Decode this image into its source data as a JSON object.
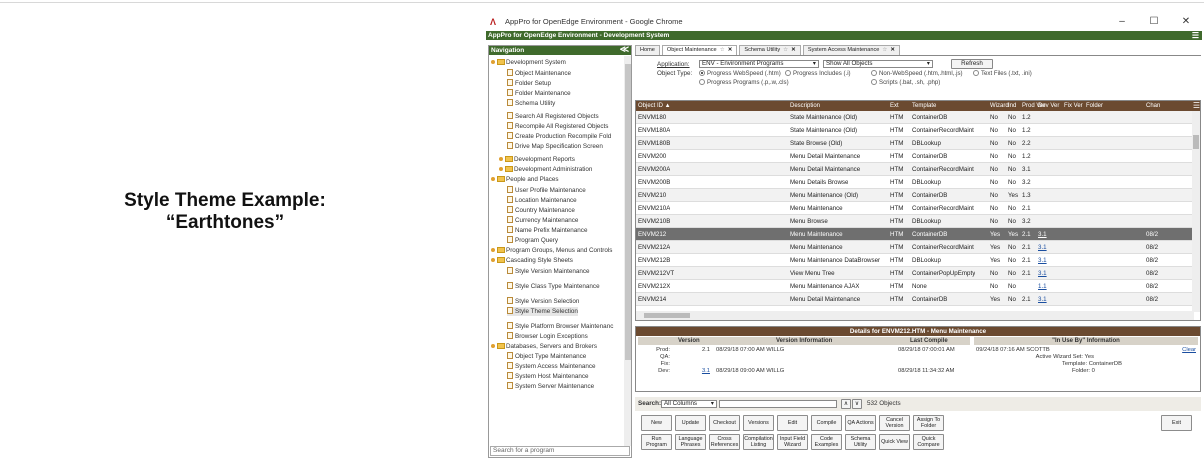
{
  "caption": {
    "line1": "Style Theme Example:",
    "line2": "“Earthtones”"
  },
  "window": {
    "title": "AppPro for OpenEdge Environment - Google Chrome",
    "app_bar": "AppPro for OpenEdge Environment - Development System",
    "minimize": "–",
    "restore": "☐",
    "close": "✕",
    "menu": "☰"
  },
  "nav": {
    "title": "Navigation",
    "collapse": "≪",
    "items": [
      {
        "label": "Development System",
        "type": "folder"
      },
      {
        "label": "Object Maintenance",
        "type": "doc"
      },
      {
        "label": "Folder Setup",
        "type": "doc"
      },
      {
        "label": "Folder Maintenance",
        "type": "doc"
      },
      {
        "label": "Schema Utility",
        "type": "doc"
      },
      {
        "label": "Search All Registered Objects",
        "type": "doc"
      },
      {
        "label": "Recompile All Registered Objects",
        "type": "doc"
      },
      {
        "label": "Create Production Recompile Fold",
        "type": "doc"
      },
      {
        "label": "Drive Map Specification Screen",
        "type": "doc"
      },
      {
        "label": "Development Reports",
        "type": "folder2"
      },
      {
        "label": "Development Administration",
        "type": "folder2"
      },
      {
        "label": "People and Places",
        "type": "folder"
      },
      {
        "label": "User Profile Maintenance",
        "type": "doc"
      },
      {
        "label": "Location Maintenance",
        "type": "doc"
      },
      {
        "label": "Country Maintenance",
        "type": "doc"
      },
      {
        "label": "Currency Maintenance",
        "type": "doc"
      },
      {
        "label": "Name Prefix Maintenance",
        "type": "doc"
      },
      {
        "label": "Program Query",
        "type": "doc"
      },
      {
        "label": "Program Groups, Menus and Controls",
        "type": "folder"
      },
      {
        "label": "Cascading Style Sheets",
        "type": "folder"
      },
      {
        "label": "Style Version Maintenance",
        "type": "doc"
      },
      {
        "label": "Style Class Type Maintenance",
        "type": "doc"
      },
      {
        "label": "Style Version Selection",
        "type": "doc"
      },
      {
        "label": "Style Theme Selection",
        "type": "doc"
      },
      {
        "label": "Style Platform Browser Maintenanc",
        "type": "doc"
      },
      {
        "label": "Browser Login Exceptions",
        "type": "doc"
      },
      {
        "label": "Databases, Servers and Brokers",
        "type": "folder"
      },
      {
        "label": "Object Type Maintenance",
        "type": "doc"
      },
      {
        "label": "System Access Maintenance",
        "type": "doc"
      },
      {
        "label": "System Host Maintenance",
        "type": "doc"
      },
      {
        "label": "System Server Maintenance",
        "type": "doc"
      }
    ],
    "search_placeholder": "Search for a program"
  },
  "tabs": [
    {
      "label": "Home",
      "closable": false
    },
    {
      "label": "Object Maintenance",
      "closable": true,
      "active": true
    },
    {
      "label": "Schema Utility",
      "closable": true
    },
    {
      "label": "System Access Maintenance",
      "closable": true
    }
  ],
  "filters": {
    "application_label": "Application:",
    "application_value": "ENV - Environment Programs",
    "show_value": "Show All Objects",
    "refresh": "Refresh",
    "object_type_label": "Object Type:",
    "radios": [
      "Progress WebSpeed (.htm)",
      "Progress Includes (.i)",
      "Non-WebSpeed (.htm,.html,.js)",
      "Text Files (.txt, .ini)",
      "Progress Programs (.p,.w,.cls)",
      "Scripts (.bat, .sh, .php)"
    ]
  },
  "grid": {
    "columns": [
      "Object ID ▲",
      "Description",
      "Ext",
      "Template",
      "Wizard",
      "Ind",
      "Prod Ver",
      "Dev Ver",
      "Fix Ver",
      "Folder",
      "Chan"
    ],
    "menu_icon": "☰",
    "rows": [
      [
        "ENVM180",
        "State Maintenance (Old)",
        "HTM",
        "ContainerDB",
        "No",
        "No",
        "1.2",
        "",
        "",
        "",
        ""
      ],
      [
        "ENVM180A",
        "State Maintenance (Old)",
        "HTM",
        "ContainerRecordMaint",
        "No",
        "No",
        "1.2",
        "",
        "",
        "",
        ""
      ],
      [
        "ENVM180B",
        "State Browse (Old)",
        "HTM",
        "DBLookup",
        "No",
        "No",
        "2.2",
        "",
        "",
        "",
        ""
      ],
      [
        "ENVM200",
        "Menu Detail Maintenance",
        "HTM",
        "ContainerDB",
        "No",
        "No",
        "1.2",
        "",
        "",
        "",
        ""
      ],
      [
        "ENVM200A",
        "Menu Detail Maintenance",
        "HTM",
        "ContainerRecordMaint",
        "No",
        "No",
        "3.1",
        "",
        "",
        "",
        ""
      ],
      [
        "ENVM200B",
        "Menu Details Browse",
        "HTM",
        "DBLookup",
        "No",
        "No",
        "3.2",
        "",
        "",
        "",
        ""
      ],
      [
        "ENVM210",
        "Menu Maintenance (Old)",
        "HTM",
        "ContainerDB",
        "No",
        "Yes",
        "1.3",
        "",
        "",
        "",
        ""
      ],
      [
        "ENVM210A",
        "Menu Maintenance",
        "HTM",
        "ContainerRecordMaint",
        "No",
        "No",
        "2.1",
        "",
        "",
        "",
        ""
      ],
      [
        "ENVM210B",
        "Menu Browse",
        "HTM",
        "DBLookup",
        "No",
        "No",
        "3.2",
        "",
        "",
        "",
        ""
      ],
      [
        "ENVM212",
        "Menu Maintenance",
        "HTM",
        "ContainerDB",
        "Yes",
        "Yes",
        "2.1",
        "3.1",
        "",
        "",
        "08/2"
      ],
      [
        "ENVM212A",
        "Menu Maintenance",
        "HTM",
        "ContainerRecordMaint",
        "Yes",
        "No",
        "2.1",
        "3.1",
        "",
        "",
        "08/2"
      ],
      [
        "ENVM212B",
        "Menu Maintenance DataBrowser",
        "HTM",
        "DBLookup",
        "Yes",
        "No",
        "2.1",
        "3.1",
        "",
        "",
        "08/2"
      ],
      [
        "ENVM212VT",
        "View Menu Tree",
        "HTM",
        "ContainerPopUpEmpty",
        "No",
        "No",
        "2.1",
        "3.1",
        "",
        "",
        "08/2"
      ],
      [
        "ENVM212X",
        "Menu Maintenance AJAX",
        "HTM",
        "None",
        "No",
        "No",
        "",
        "1.1",
        "",
        "",
        "08/2"
      ],
      [
        "ENVM214",
        "Menu Detail Maintenance",
        "HTM",
        "ContainerDB",
        "Yes",
        "No",
        "2.1",
        "3.1",
        "",
        "",
        "08/2"
      ]
    ],
    "selected_index": 9
  },
  "details": {
    "title": "Details for ENVM212.HTM - Menu Maintenance",
    "col_version": "Version",
    "col_info": "Version Information",
    "col_compile": "Last Compile",
    "col_inuse": "\"In Use By\" Information",
    "labels": [
      "Prod:",
      "QA:",
      "Fix:",
      "Dev:"
    ],
    "prod_ver": "2.1",
    "prod_info": "08/29/18 07:00 AM WILLG",
    "prod_compile": "08/29/18 07:00:01 AM",
    "dev_ver": "3.1",
    "dev_info": "08/29/18 09:00 AM WILLG",
    "dev_compile": "08/29/18 11:34:32 AM",
    "inuse": "09/24/18 07:16 AM SCOTTB",
    "clear": "Clear",
    "wizard_set": "Active Wizard Set: Yes",
    "template": "Template: ContainerDB",
    "folder": "Folder: 0"
  },
  "search": {
    "label": "Search:",
    "value": "All Columns",
    "count": "532 Objects"
  },
  "buttons_row1": [
    "New",
    "Update",
    "Checkout",
    "Versions",
    "Edit",
    "Compile",
    "QA Actions",
    "Cancel Version",
    "Assign To Folder"
  ],
  "buttons_row2": [
    "Run Program",
    "Language Phrases",
    "Cross References",
    "Compilation Listing",
    "Input Field Wizard",
    "Code Examples",
    "Schema Utility",
    "Quick View",
    "Quick Compare"
  ],
  "exit": "Exit"
}
